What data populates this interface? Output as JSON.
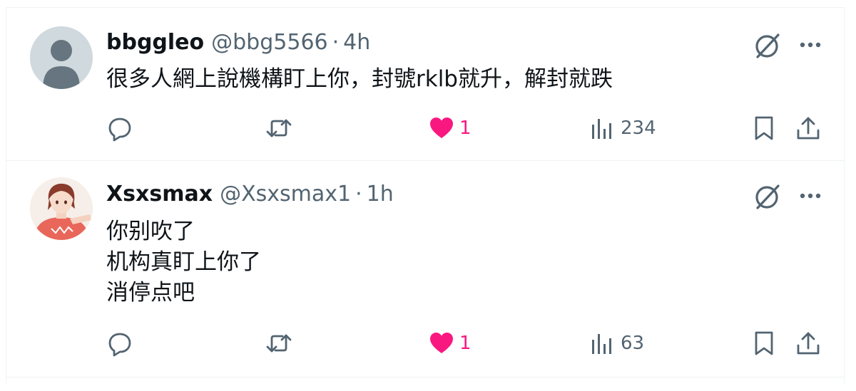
{
  "posts": [
    {
      "display_name": "bbggleo",
      "handle": "@bbg5566",
      "separator": "·",
      "time": "4h",
      "text_lines": [
        "很多人網上說機構盯上你，封號rklb就升，解封就跌"
      ],
      "likes": "1",
      "views": "234",
      "liked": true
    },
    {
      "display_name": "Xsxsmax",
      "handle": "@Xsxsmax1",
      "separator": "·",
      "time": "1h",
      "text_lines": [
        "你别吹了",
        "机构真盯上你了",
        "消停点吧"
      ],
      "likes": "1",
      "views": "63",
      "liked": true
    }
  ],
  "icons": {
    "reply": "reply-icon",
    "repost": "repost-icon",
    "like": "heart-icon",
    "views": "views-icon",
    "bookmark": "bookmark-icon",
    "share": "share-icon",
    "grok": "grok-icon",
    "more": "more-icon"
  },
  "colors": {
    "text": "#0f1419",
    "secondary": "#536471",
    "like": "#f91880",
    "divider": "#eff3f4"
  }
}
